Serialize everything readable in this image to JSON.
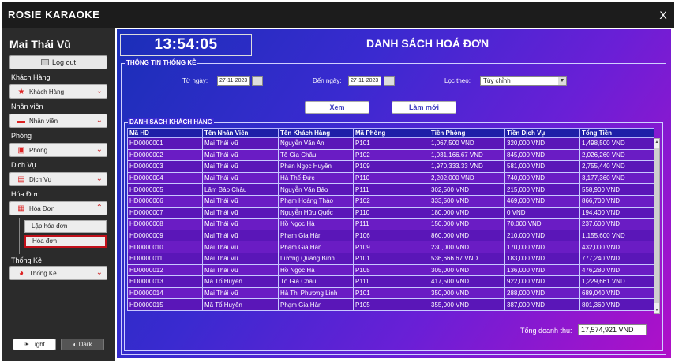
{
  "window": {
    "title": "ROSIE KARAOKE",
    "minimize": "_",
    "close": "X"
  },
  "sidebar": {
    "user": "Mai Thái Vũ",
    "logout": "Log out",
    "sections": [
      {
        "label": "Khách Hàng",
        "combo": "Khách Hàng",
        "icon": "star-icon",
        "arrow": "⌄"
      },
      {
        "label": "Nhân viên",
        "combo": "Nhân viên",
        "icon": "id-card-icon",
        "arrow": "⌄"
      },
      {
        "label": "Phòng",
        "combo": "Phòng",
        "icon": "room-icon",
        "arrow": "⌄"
      },
      {
        "label": "Dịch Vụ",
        "combo": "Dịch Vụ",
        "icon": "service-icon",
        "arrow": "⌄"
      },
      {
        "label": "Hóa Đơn",
        "combo": "Hóa Đơn",
        "icon": "invoice-icon",
        "arrow": "⌃"
      },
      {
        "label": "Thống Kê",
        "combo": "Thống Kê",
        "icon": "pie-chart-icon",
        "arrow": "⌄"
      }
    ],
    "submenu": {
      "item1": "Lập hóa đơn",
      "item2": "Hóa đơn"
    },
    "theme": {
      "light": "Light",
      "dark": "Dark"
    }
  },
  "main": {
    "clock": "13:54:05",
    "heading": "DANH SÁCH HOÁ ĐƠN",
    "stats_group": "THÔNG TIN THỐNG KÊ",
    "from_label": "Từ ngày:",
    "from_value": "27-11-2023",
    "to_label": "Đến ngày:",
    "to_value": "27-11-2023",
    "filter_label": "Lọc theo:",
    "filter_value": "Tùy chỉnh",
    "view_button": "Xem",
    "refresh_button": "Làm mới",
    "list_group": "DANH SÁCH KHÁCH HÀNG",
    "total_label": "Tổng doanh thu:",
    "total_value": "17,574,921 VND"
  },
  "table": {
    "columns": [
      "Mã HD",
      "Tên Nhân Viên",
      "Tên Khách Hàng",
      "Mã Phòng",
      "Tiền Phòng",
      "Tiền Dịch Vụ",
      "Tổng Tiền"
    ],
    "rows": [
      [
        "HD0000001",
        "Mai Thái Vũ",
        "Nguyễn Văn An",
        "P101",
        "1,067,500 VND",
        "320,000 VND",
        "1,498,500 VND"
      ],
      [
        "HD0000002",
        "Mai Thái Vũ",
        "Tô Gia Châu",
        "P102",
        "1,031,166.67 VND",
        "845,000 VND",
        "2,026,260 VND"
      ],
      [
        "HD0000003",
        "Mai Thái Vũ",
        "Phan Ngọc Huyền",
        "P109",
        "1,970,333.33 VND",
        "581,000 VND",
        "2,755,440 VND"
      ],
      [
        "HD0000004",
        "Mai Thái Vũ",
        "Hà Thế Đức",
        "P110",
        "2,202,000 VND",
        "740,000 VND",
        "3,177,360 VND"
      ],
      [
        "HD0000005",
        "Lâm Bảo Châu",
        "Nguyễn Văn Bảo",
        "P111",
        "302,500 VND",
        "215,000 VND",
        "558,900 VND"
      ],
      [
        "HD0000006",
        "Mai Thái Vũ",
        "Phạm Hoàng Thảo",
        "P102",
        "333,500 VND",
        "469,000 VND",
        "866,700 VND"
      ],
      [
        "HD0000007",
        "Mai Thái Vũ",
        "Nguyễn Hữu Quốc",
        "P110",
        "180,000 VND",
        "0 VND",
        "194,400 VND"
      ],
      [
        "HD0000008",
        "Mai Thái Vũ",
        "Hồ Ngọc Hà",
        "P111",
        "150,000 VND",
        "70,000 VND",
        "237,600 VND"
      ],
      [
        "HD0000009",
        "Mai Thái Vũ",
        "Phạm Gia Hân",
        "P106",
        "860,000 VND",
        "210,000 VND",
        "1,155,600 VND"
      ],
      [
        "HD0000010",
        "Mai Thái Vũ",
        "Phạm Gia Hân",
        "P109",
        "230,000 VND",
        "170,000 VND",
        "432,000 VND"
      ],
      [
        "HD0000011",
        "Mai Thái Vũ",
        "Lương Quang Bình",
        "P101",
        "536,666.67 VND",
        "183,000 VND",
        "777,240 VND"
      ],
      [
        "HD0000012",
        "Mai Thái Vũ",
        "Hồ Ngọc Hà",
        "P105",
        "305,000 VND",
        "136,000 VND",
        "476,280 VND"
      ],
      [
        "HD0000013",
        "Mã Tố Huyên",
        "Tô Gia Châu",
        "P111",
        "417,500 VND",
        "922,000 VND",
        "1,229,661 VND"
      ],
      [
        "HD0000014",
        "Mai Thái Vũ",
        "Hà Thị Phương Linh",
        "P101",
        "350,000 VND",
        "288,000 VND",
        "689,040 VND"
      ],
      [
        "HD0000015",
        "Mã Tố Huyên",
        "Phạm Gia Hân",
        "P105",
        "355,000 VND",
        "387,000 VND",
        "801,360 VND"
      ]
    ]
  }
}
